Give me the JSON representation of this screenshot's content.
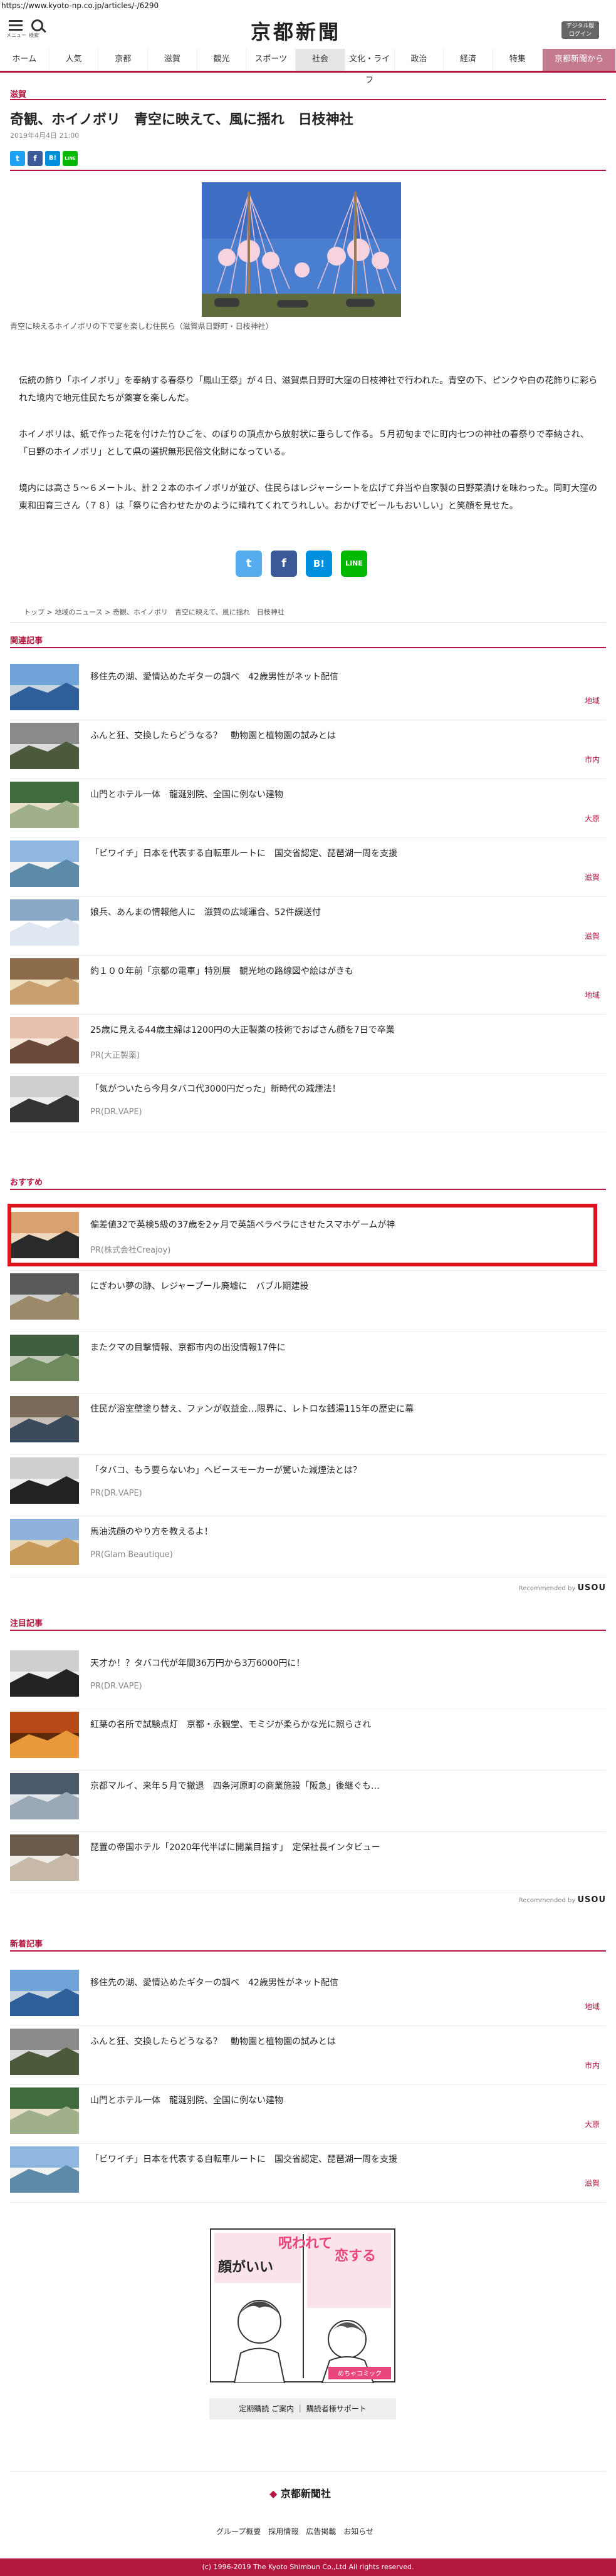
{
  "url": "https://www.kyoto-np.co.jp/articles/-/6290",
  "header": {
    "menu_label": "メニュー",
    "search_label": "検索",
    "logo": "京都新聞",
    "login_label": "ログイン",
    "login_label_prefix": "デジタル版"
  },
  "nav": [
    "ホーム",
    "人気",
    "京都",
    "滋賀",
    "観光",
    "スポーツ",
    "社会",
    "文化・ライフ",
    "政治",
    "経済",
    "特集"
  ],
  "nav_active": "社会",
  "nav_special": "京都新聞から",
  "article": {
    "category": "滋賀",
    "title": "奇観、ホイノボリ　青空に映えて、風に揺れ　日枝神社",
    "date": "2019年4月4日 21:00",
    "caption": "青空に映えるホイノボリの下で宴を楽しむ住民ら（滋賀県日野町・日枝神社）",
    "paragraphs": [
      "伝統の飾り「ホイノボリ」を奉納する春祭り「鳳山王祭」が４日、滋賀県日野町大窪の日枝神社で行われた。青空の下、ピンクや白の花飾りに彩られた境内で地元住民たちが薬宴を楽しんだ。",
      "ホイノボリは、紙で作った花を付けた竹ひごを、のぼりの頂点から放射状に垂らして作る。５月初旬までに町内七つの神社の春祭りで奉納され、「日野のホイノボリ」として県の選択無形民俗文化財になっている。",
      "境内には高さ５～６メートル、計２２本のホイノボリが並び、住民らはレジャーシートを広げて弁当や自家製の日野菜漬けを味わった。同町大窪の東和田育三さん（７８）は「祭りに合わせたかのように晴れてくれてうれしい。おかげでビールもおいしい」と笑顔を見せた。"
    ],
    "breadcrumb": [
      "トップ",
      "地域のニュース",
      "奇観、ホイノボリ　青空に映えて、風に揺れ　日枝神社"
    ]
  },
  "share": {
    "twitter": "t",
    "facebook": "f",
    "hatena": "B!",
    "line": "LINE"
  },
  "related": {
    "heading": "関連記事",
    "items": [
      {
        "title": "移住先の湖、愛情込めたギターの調べ　42歳男性がネット配信",
        "tag": "地域"
      },
      {
        "title": "ふんと狂、交換したらどうなる？　動物園と植物園の試みとは",
        "tag": "市内"
      },
      {
        "title": "山門とホテル一体　龍涎別院、全国に例ない建物",
        "tag": "大原"
      },
      {
        "title": "「ビワイチ」日本を代表する自転車ルートに　国交省認定、琵琶湖一周を支援",
        "tag": "滋賀"
      },
      {
        "title": "娘兵、あんまの情報他人に　滋賀の広域運合、52件誤送付",
        "tag": "滋賀"
      },
      {
        "title": "約１００年前「京都の電車」特別展　観光地の路線図や絵はがきも",
        "tag": "地域"
      },
      {
        "title": "25歳に見える44歳主婦は1200円の大正製薬の技術でおばさん顔を7日で卒業",
        "pr": "PR(大正製薬)"
      },
      {
        "title": "「気がついたら今月タバコ代3000円だった」新時代の減煙法！",
        "pr": "PR(DR.VAPE)"
      }
    ]
  },
  "recommended": {
    "heading": "おすすめ",
    "items": [
      {
        "title": "偏差値32で英検5級の37歳を2ヶ月で英語ペラペラにさせたスマホゲームが神",
        "pr": "PR(株式会社Creajoy)"
      },
      {
        "title": "にぎわい夢の跡、レジャープール廃墟に　バブル期建設"
      },
      {
        "title": "またクマの目撃情報、京都市内の出没情報17件に"
      },
      {
        "title": "住民が浴室壁塗り替え、ファンが収益金…限界に、レトロな銭湯115年の歴史に幕"
      },
      {
        "title": "「タバコ、もう要らないわ」ヘビースモーカーが驚いた減煙法とは？",
        "pr": "PR(DR.VAPE)"
      },
      {
        "title": "馬油洗顔のやり方を教えるよ！",
        "pr": "PR(Glam Beautique)"
      }
    ],
    "credit_prefix": "Recommended by",
    "credit_brand": "USOU"
  },
  "featured": {
    "heading": "注目記事",
    "items": [
      {
        "title": "天才か！？タバコ代が年間36万円から3万6000円に！",
        "pr": "PR(DR.VAPE)"
      },
      {
        "title": "紅葉の名所で試験点灯　京都・永観堂、モミジが柔らかな光に照らされ"
      },
      {
        "title": "京都マルイ、来年５月で撤退　四条河原町の商業施設「阪急」後継ぐも…"
      },
      {
        "title": "琵置の帝国ホテル「2020年代半ばに開業目指す」　定保社長インタビュー"
      }
    ],
    "credit_prefix": "Recommended by",
    "credit_brand": "USOU"
  },
  "latest": {
    "heading": "新着記事",
    "items": [
      {
        "title": "移住先の湖、愛情込めたギターの調べ　42歳男性がネット配信",
        "tag": "地域"
      },
      {
        "title": "ふんと狂、交換したらどうなる？　動物園と植物園の試みとは",
        "tag": "市内"
      },
      {
        "title": "山門とホテル一体　龍涎別院、全国に例ない建物",
        "tag": "大原"
      },
      {
        "title": "「ビワイチ」日本を代表する自転車ルートに　国交省認定、琵琶湖一周を支援",
        "tag": "滋賀"
      }
    ]
  },
  "ad": {
    "lines": [
      "呪われて",
      "恋する",
      "顔がいい"
    ],
    "brand": "めちゃコミック"
  },
  "footer": {
    "buttons": "定期購読 ご案内 ｜ 購読者様サポート",
    "logo": "京都新聞社",
    "links": "グループ概要　採用情報　広告掲載　お知らせ",
    "copyright": "(c) 1996-2019 The Kyoto Shimbun Co.,Ltd All rights reserved."
  },
  "colors": {
    "brand": "#b3173f",
    "highlight": "#e0141e"
  }
}
